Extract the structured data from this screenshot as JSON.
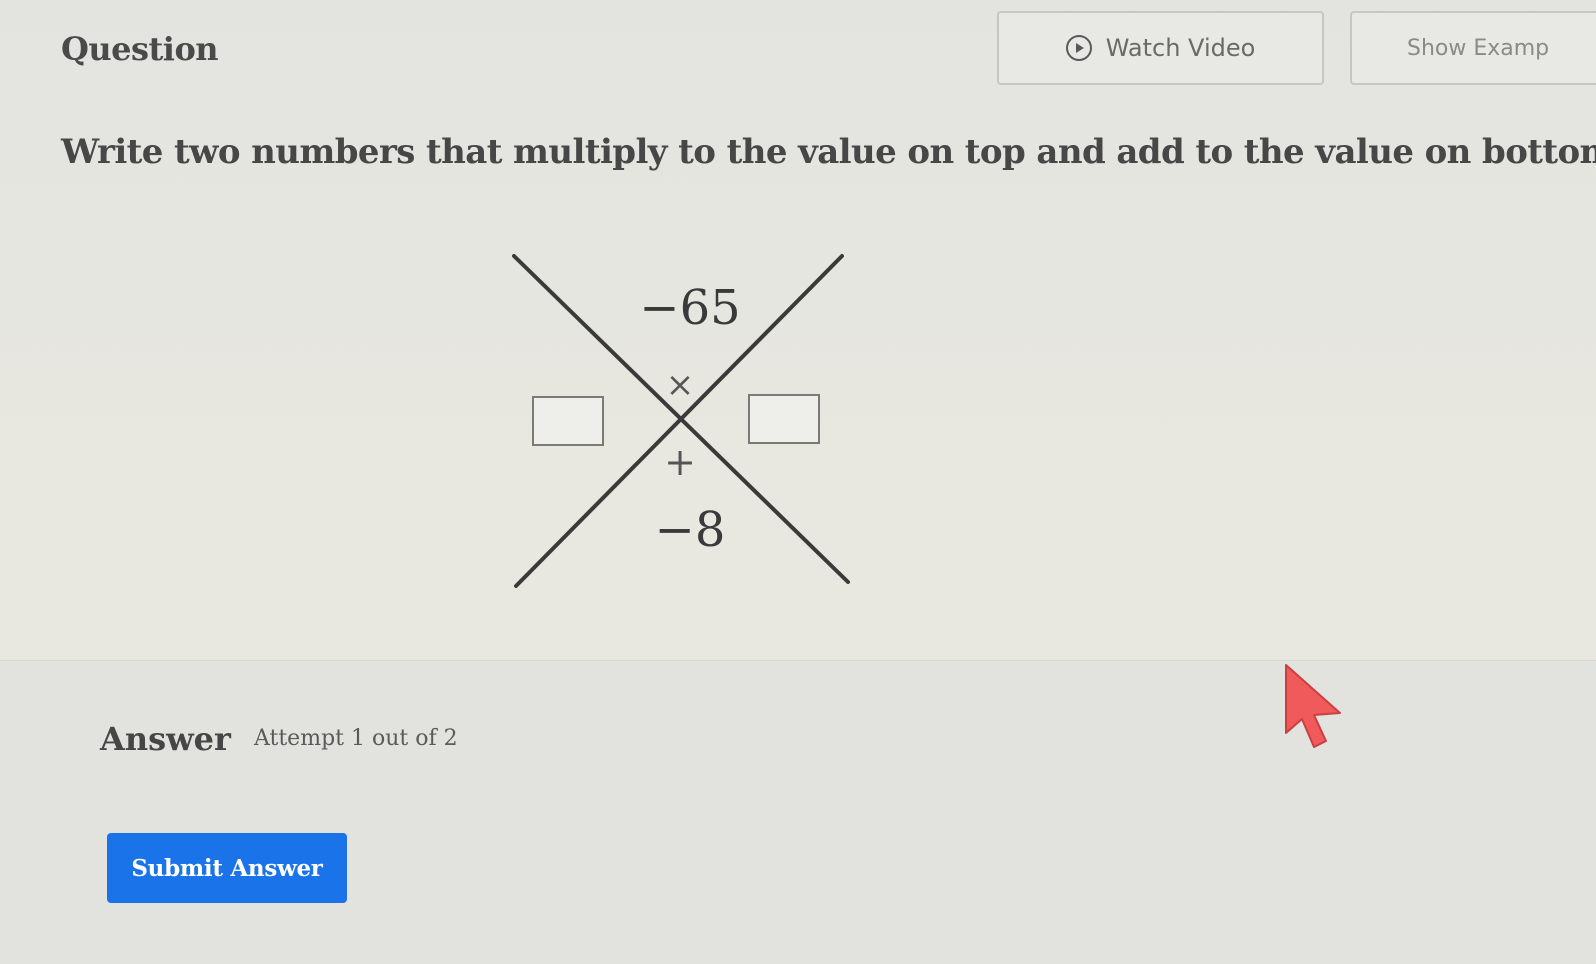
{
  "header": {
    "title": "Question",
    "watch_video_label": "Watch Video",
    "show_example_label": "Show Examp"
  },
  "question": {
    "instructions": "Write two numbers that multiply to the value on top and add to the value on bottom.",
    "diagram": {
      "top_value": "−65",
      "bottom_value": "−8",
      "multiply_symbol": "×",
      "add_symbol": "+",
      "left_input_value": "",
      "right_input_value": ""
    }
  },
  "answer": {
    "label": "Answer",
    "attempt_text": "Attempt 1 out of 2",
    "submit_label": "Submit Answer"
  },
  "colors": {
    "submit_button": "#1a73e8",
    "cursor": "#f05a5a"
  },
  "icons": {
    "watch_video": "play-circle-icon",
    "pointer": "mouse-cursor-icon"
  }
}
